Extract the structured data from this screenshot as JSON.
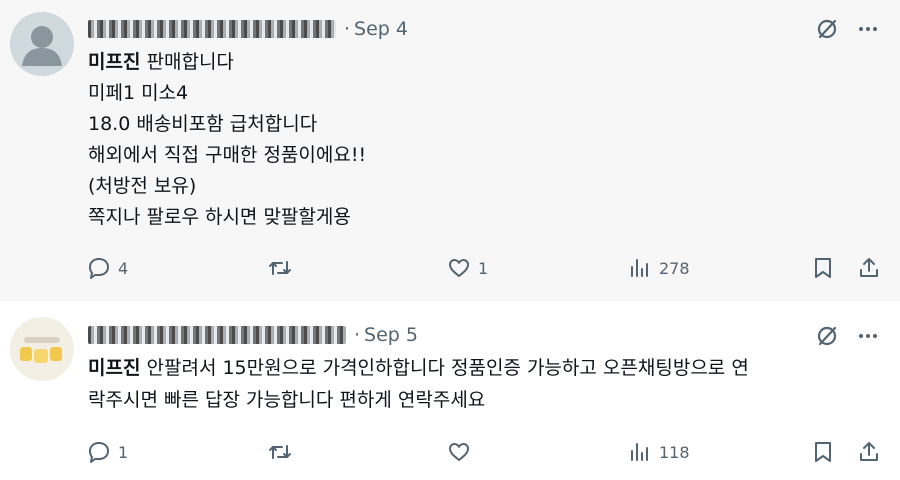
{
  "posts": [
    {
      "date": "Sep 4",
      "name": "미프진",
      "lines": [
        "판매합니다",
        "미페1 미소4",
        "18.0 배송비포함 급처합니다",
        "해외에서 직접 구매한 정품이에요!!",
        "(처방전 보유)",
        "쪽지나 팔로우 하시면 맞팔할게용"
      ],
      "replies": "4",
      "reposts": "",
      "likes": "1",
      "views": "278"
    },
    {
      "date": "Sep 5",
      "name": "미프진",
      "lines": [
        "안팔려서 15만원으로 가격인하합니다 정품인증 가능하고 오픈채팅방으로 연",
        "락주시면 빠른 답장 가능합니다 편하게 연락주세요"
      ],
      "replies": "1",
      "reposts": "",
      "likes": "",
      "views": "118"
    }
  ],
  "icons": {
    "grok": "grok-icon",
    "more": "more-icon",
    "reply": "reply-icon",
    "repost": "repost-icon",
    "like": "like-icon",
    "views": "views-icon",
    "bookmark": "bookmark-icon",
    "share": "share-icon"
  },
  "colors": {
    "text": "#0f1419",
    "muted": "#536471",
    "first_post_bg": "#f7f7f7",
    "avatar_default": "#cfd9de"
  }
}
